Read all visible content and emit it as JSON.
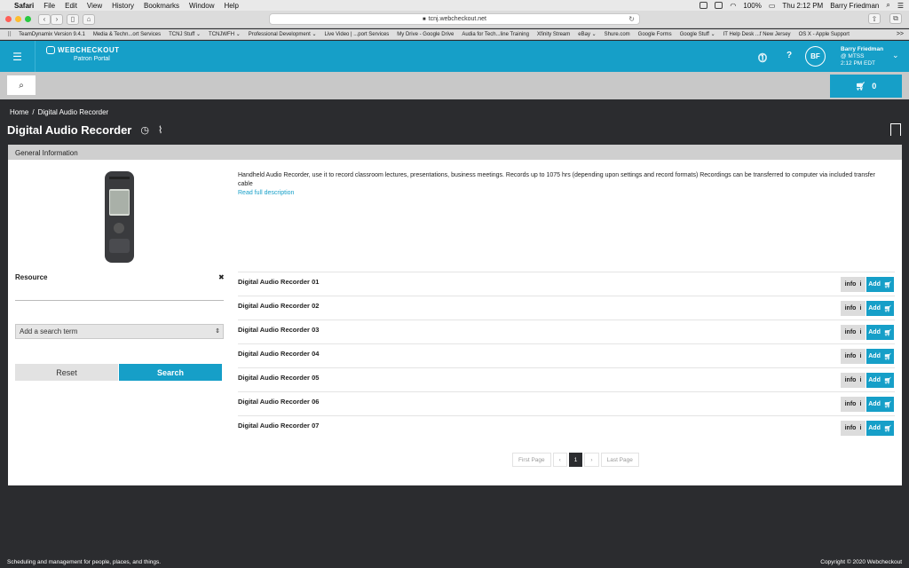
{
  "menubar": {
    "app": "Safari",
    "items": [
      "File",
      "Edit",
      "View",
      "History",
      "Bookmarks",
      "Window",
      "Help"
    ],
    "battery": "100%",
    "clock": "Thu 2:12 PM",
    "user": "Barry Friedman"
  },
  "browser": {
    "url": "tcnj.webcheckout.net",
    "bookmarks": [
      "TeamDynamix Version 9.4.1",
      "Media & Techn...ort Services",
      "TCNJ Stuff ⌄",
      "TCNJWFH ⌄",
      "Professional Development ⌄",
      "Live Video | ...port Services",
      "My Drive - Google Drive",
      "Audia for Tech...line Training",
      "Xfinity Stream",
      "eBay ⌄",
      "Shure.com",
      "Google Forms",
      "Google Stuff ⌄",
      "IT Help Desk ...f New Jersey",
      "OS X - Apple Support"
    ],
    "bookmarks_more": ">>"
  },
  "header": {
    "brand": "WEBCHECKOUT",
    "portal": "Patron Portal",
    "user_initials": "BF",
    "user_name": "Barry Friedman",
    "user_org": "@ MTSS",
    "user_time": "2:12 PM EDT"
  },
  "cart": {
    "count": "0"
  },
  "breadcrumb": {
    "home": "Home",
    "sep": "/",
    "current": "Digital Audio Recorder"
  },
  "page": {
    "title": "Digital Audio Recorder",
    "section": "General Information",
    "description": "Handheld Audio Recorder, use it to record classroom lectures, presentations, business meetings. Records up to 1075 hrs (depending upon settings and record formats)  Recordings can be transferred to computer via included transfer cable",
    "read_more": "Read full description"
  },
  "filter": {
    "resource_label": "Resource",
    "add_term": "Add a search term",
    "reset": "Reset",
    "search": "Search"
  },
  "items": [
    {
      "name": "Digital Audio Recorder 01"
    },
    {
      "name": "Digital Audio Recorder 02"
    },
    {
      "name": "Digital Audio Recorder 03"
    },
    {
      "name": "Digital Audio Recorder 04"
    },
    {
      "name": "Digital Audio Recorder 05"
    },
    {
      "name": "Digital Audio Recorder 06"
    },
    {
      "name": "Digital Audio Recorder 07"
    }
  ],
  "item_buttons": {
    "info": "info",
    "info_glyph": "i",
    "add": "Add"
  },
  "pager": {
    "first": "First Page",
    "prev": "‹",
    "current": "1",
    "next": "›",
    "last": "Last Page"
  },
  "footer": {
    "left": "Scheduling and management for people, places, and things.",
    "right": "Copyright © 2020 Webcheckout"
  },
  "colors": {
    "accent": "#169fc8",
    "dark_bg": "#2b2c2f"
  }
}
